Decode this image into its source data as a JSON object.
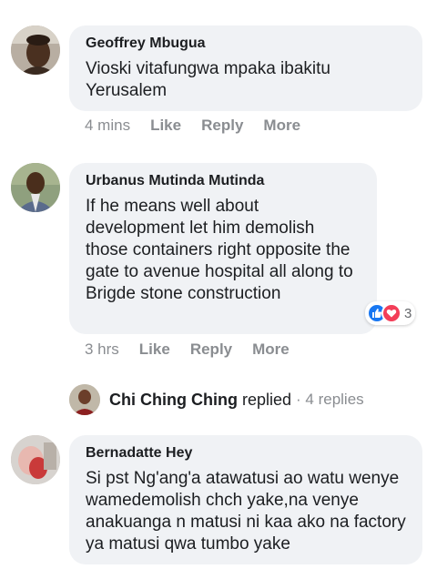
{
  "comments": [
    {
      "author": "Geoffrey Mbugua",
      "text": "Vioski vitafungwa mpaka ibakitu Yerusalem",
      "time": "4 mins",
      "like": "Like",
      "reply": "Reply",
      "more": "More"
    },
    {
      "author": "Urbanus Mutinda Mutinda",
      "text": "If he means well about development let him demolish those containers right opposite the gate to avenue hospital all along to Brigde stone construction",
      "time": "3 hrs",
      "like": "Like",
      "reply": "Reply",
      "more": "More",
      "reaction_count": "3",
      "reaction_icons": [
        "like-icon",
        "love-icon"
      ],
      "reaction_colors": {
        "like": "#1877f2",
        "love": "#f33e58"
      }
    },
    {
      "author": "Bernadatte Hey",
      "text": "Si pst Ng'ang'a atawatusi ao watu wenye wamedemolish chch yake,na venye anakuanga n matusi ni kaa ako na factory ya matusi qwa tumbo yake"
    }
  ],
  "replies_summary": {
    "name": "Chi Ching Ching",
    "verb": "replied",
    "count": "· 4 replies"
  },
  "colors": {
    "bubble": "#f0f2f5",
    "meta": "#8a8d91",
    "text": "#1c1e21"
  }
}
